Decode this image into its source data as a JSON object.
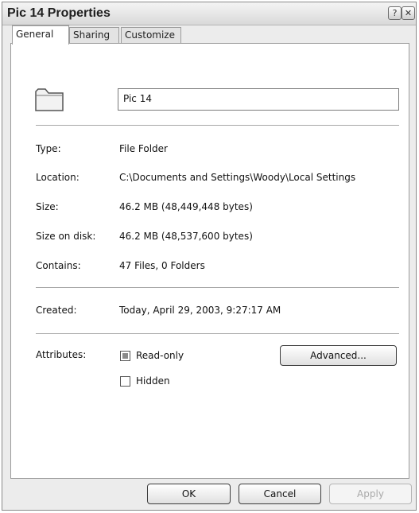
{
  "window": {
    "title": "Pic 14 Properties",
    "help_label": "?",
    "close_label": "✕"
  },
  "tabs": [
    {
      "label": "General"
    },
    {
      "label": "Sharing"
    },
    {
      "label": "Customize"
    }
  ],
  "general": {
    "folder_name": "Pic 14",
    "folder_icon": "folder-icon",
    "type_label": "Type:",
    "type_value": "File Folder",
    "location_label": "Location:",
    "location_value": "C:\\Documents and Settings\\Woody\\Local Settings",
    "size_label": "Size:",
    "size_value": "46.2 MB (48,449,448 bytes)",
    "size_on_disk_label": "Size on disk:",
    "size_on_disk_value": "46.2 MB (48,537,600 bytes)",
    "contains_label": "Contains:",
    "contains_value": "47 Files, 0 Folders",
    "created_label": "Created:",
    "created_value": "Today, April 29, 2003, 9:27:17 AM",
    "attributes_label": "Attributes:",
    "readonly_label": "Read-only",
    "readonly_state": "indeterminate",
    "hidden_label": "Hidden",
    "hidden_state": "unchecked",
    "advanced_label": "Advanced..."
  },
  "footer": {
    "ok_label": "OK",
    "cancel_label": "Cancel",
    "apply_label": "Apply"
  }
}
